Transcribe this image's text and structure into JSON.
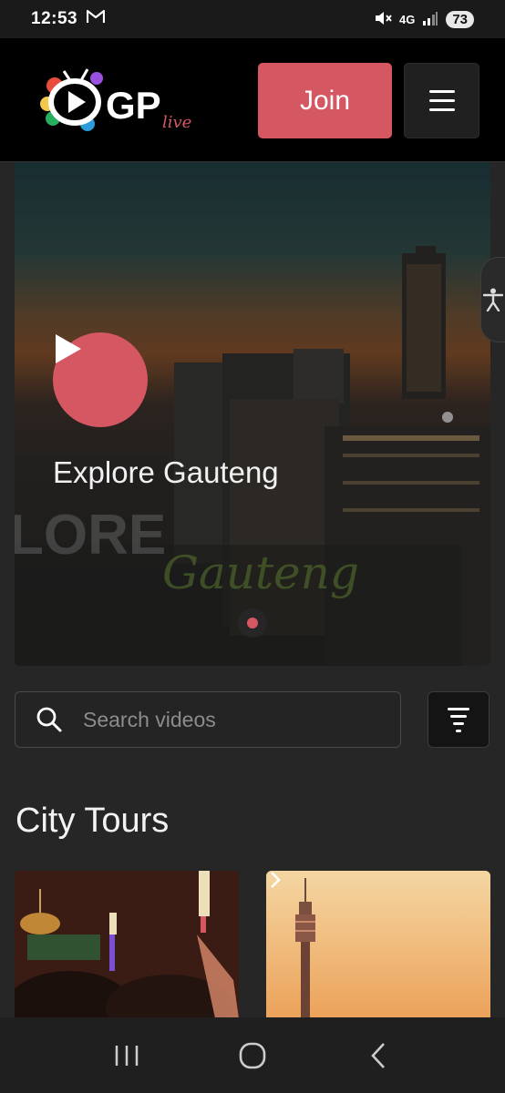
{
  "status_bar": {
    "time": "12:53",
    "network": "4G",
    "battery": "73"
  },
  "header": {
    "logo_text": "GP",
    "logo_subtext": "live",
    "join_label": "Join"
  },
  "hero": {
    "title": "Explore Gauteng",
    "watermark_text": "LORE",
    "watermark_script": "Gauteng"
  },
  "search": {
    "placeholder": "Search videos"
  },
  "section": {
    "title": "City Tours"
  },
  "colors": {
    "accent": "#d45762",
    "header_bg": "#000000",
    "page_bg": "#262626"
  },
  "icons": {
    "status": [
      "gmail-icon",
      "mute-icon",
      "signal-icon",
      "battery-icon"
    ],
    "header": [
      "gp-live-logo",
      "hamburger-menu-icon"
    ],
    "hero": [
      "play-icon",
      "accessibility-icon"
    ],
    "search": [
      "search-icon",
      "filter-icon"
    ],
    "nav": [
      "recent-apps-icon",
      "home-icon",
      "back-icon"
    ]
  }
}
